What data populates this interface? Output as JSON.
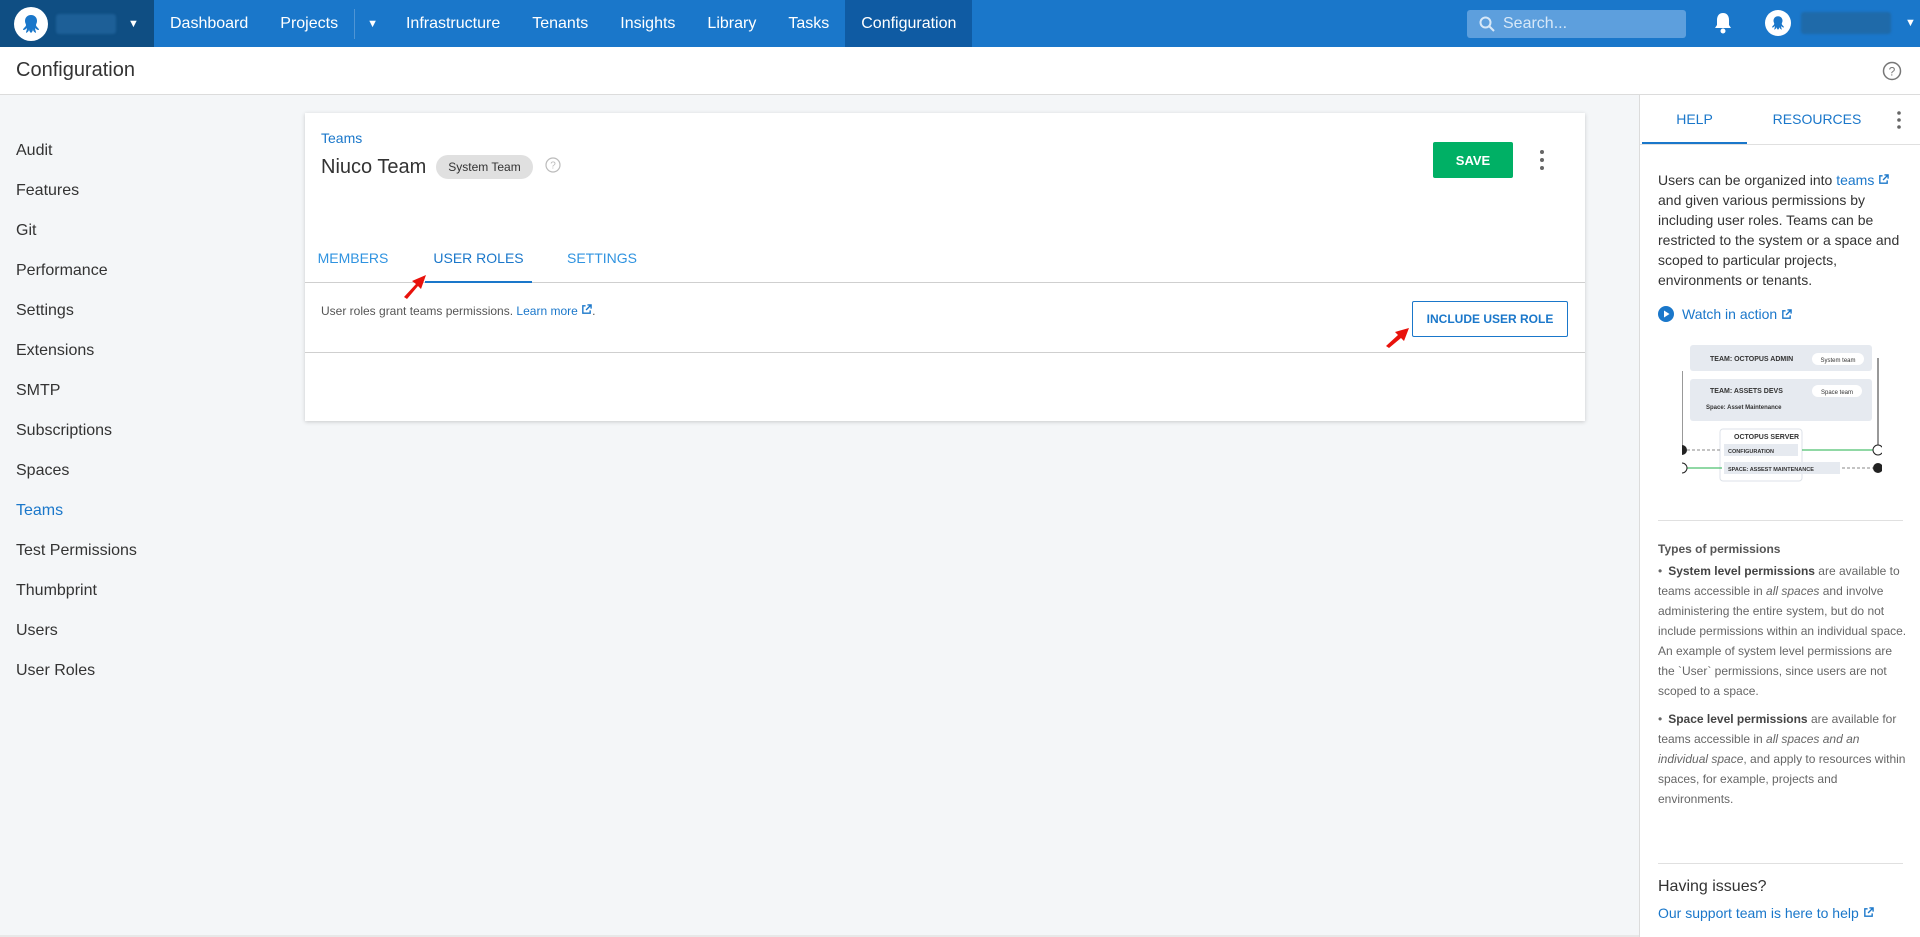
{
  "nav": {
    "items": [
      "Dashboard",
      "Projects",
      "Infrastructure",
      "Tenants",
      "Insights",
      "Library",
      "Tasks",
      "Configuration"
    ],
    "active": "Configuration",
    "search_placeholder": "Search..."
  },
  "header": {
    "title": "Configuration"
  },
  "sidebar": {
    "items": [
      {
        "label": "Audit"
      },
      {
        "label": "Features"
      },
      {
        "label": "Git"
      },
      {
        "label": "Performance"
      },
      {
        "label": "Settings"
      },
      {
        "label": "Extensions"
      },
      {
        "label": "SMTP"
      },
      {
        "label": "Subscriptions"
      },
      {
        "label": "Spaces"
      },
      {
        "label": "Teams",
        "active": true
      },
      {
        "label": "Test Permissions"
      },
      {
        "label": "Thumbprint"
      },
      {
        "label": "Users"
      },
      {
        "label": "User Roles"
      }
    ]
  },
  "team": {
    "breadcrumb": "Teams",
    "name": "Niuco Team",
    "chip": "System Team",
    "save_label": "SAVE",
    "tabs": [
      "MEMBERS",
      "USER ROLES",
      "SETTINGS"
    ],
    "active_tab": "USER ROLES",
    "description": "User roles grant teams permissions.",
    "learn_more": "Learn more",
    "include_label": "INCLUDE USER ROLE"
  },
  "help": {
    "tabs": [
      "HELP",
      "RESOURCES"
    ],
    "intro_1": "Users can be organized into ",
    "intro_link": "teams",
    "intro_2": " and given various permissions by including user roles. Teams can be restricted to the system or a space and scoped to particular projects, environments or tenants.",
    "watch": "Watch in action",
    "diagram": {
      "team_admin": "TEAM: OCTOPUS ADMIN",
      "system_team": "System team",
      "team_devs": "TEAM: ASSETS DEVS",
      "space_team": "Space team",
      "space_label": "Space: Asset Maintenance",
      "server": "OCTOPUS SERVER",
      "configuration": "CONFIGURATION",
      "space_maint": "SPACE: ASSEST MAINTENANCE"
    },
    "types_title": "Types of permissions",
    "system_bold": "System level permissions",
    "system_text_1": " are available to teams accessible in ",
    "system_italic": "all spaces",
    "system_text_2": " and involve administering the entire system, but do not include permissions within an individual space. An example of system level permissions are the `User` permissions, since users are not scoped to a space.",
    "space_bold": "Space level permissions",
    "space_text_1": " are available for teams accessible in ",
    "space_italic": "all spaces and an individual space",
    "space_text_2": ", and apply to resources within spaces, for example, projects and environments.",
    "issues_title": "Having issues?",
    "issues_link": "Our support team is here to help"
  }
}
